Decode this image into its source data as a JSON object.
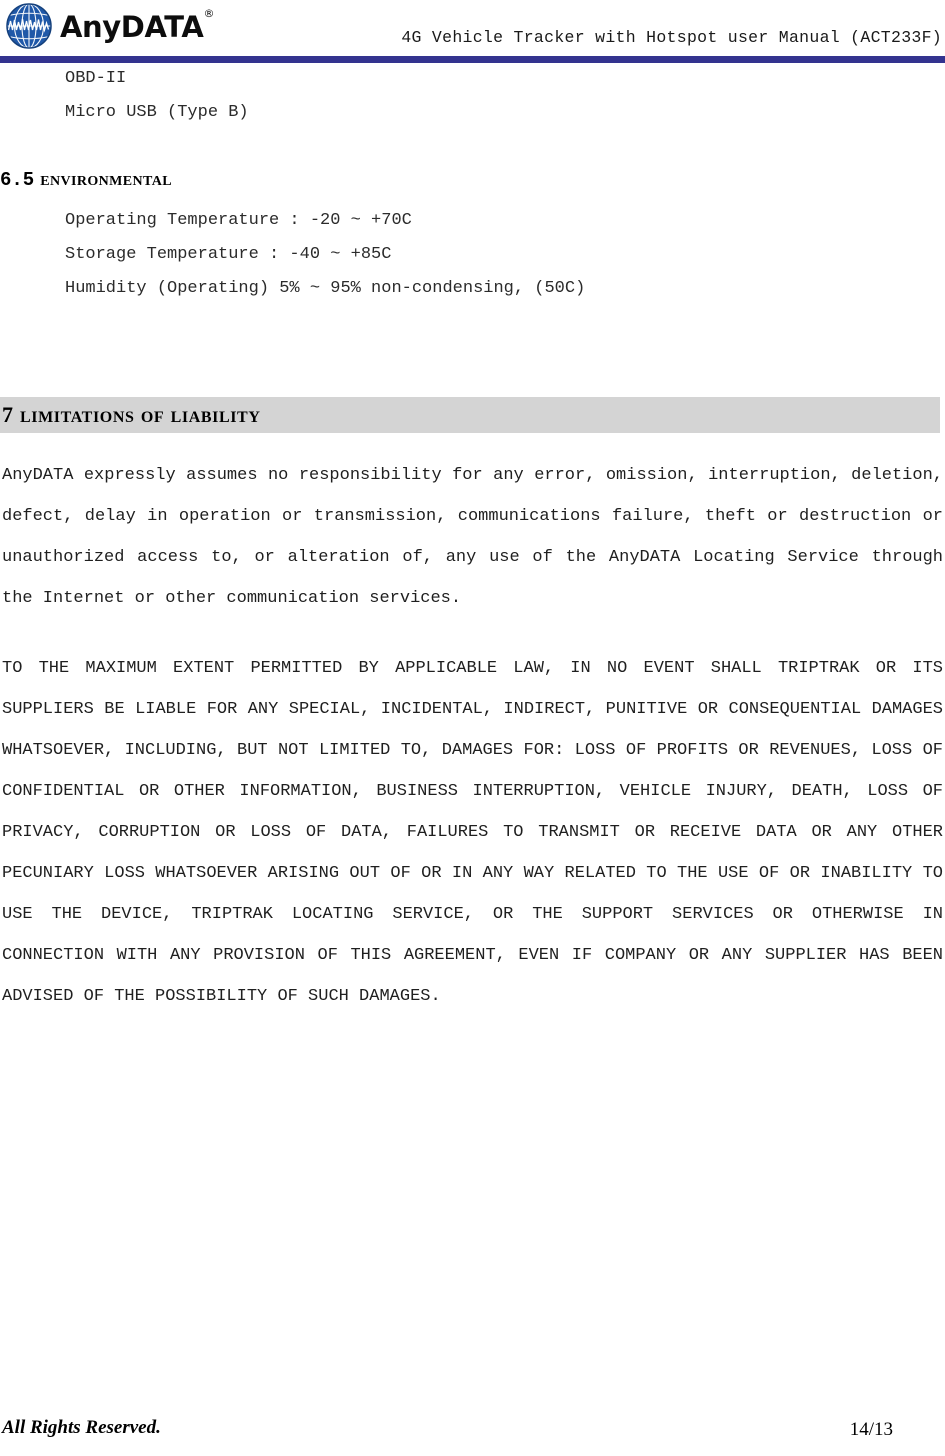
{
  "header": {
    "brand_name": "AnyDATA",
    "brand_trademark": "®",
    "logo_icon": "globe-icon",
    "title": "4G Vehicle Tracker with Hotspot user Manual (ACT233F)",
    "rule_color": "#33338f"
  },
  "content": {
    "interface_specs": [
      "OBD-II",
      "Micro USB (Type B)"
    ],
    "environmental_heading": {
      "number": "6.5",
      "title": "Environmental"
    },
    "environmental_specs": [
      "Operating Temperature : -20 ~ +70C",
      "Storage Temperature : -40 ~ +85C",
      "Humidity (Operating) 5% ~ 95% non-condensing, (50C)"
    ],
    "liability_heading": {
      "number": "7",
      "title": "Limitations of Liability",
      "band_color": "#d4d4d4"
    },
    "paragraphs": [
      "AnyDATA expressly assumes no responsibility for any error, omission, interruption, deletion, defect, delay in operation or transmission, communications failure, theft or destruction or unauthorized access to, or alteration of, any use of the AnyDATA Locating Service through the Internet or other communication services.",
      "TO THE MAXIMUM EXTENT PERMITTED BY APPLICABLE LAW, IN NO EVENT SHALL TRIPTRAK OR ITS SUPPLIERS BE LIABLE FOR ANY SPECIAL, INCIDENTAL, INDIRECT, PUNITIVE OR CONSEQUENTIAL DAMAGES WHATSOEVER, INCLUDING, BUT NOT LIMITED TO, DAMAGES FOR: LOSS OF PROFITS OR REVENUES, LOSS OF CONFIDENTIAL OR OTHER INFORMATION, BUSINESS  INTERRUPTION, VEHICLE INJURY, DEATH, LOSS OF PRIVACY, CORRUPTION OR LOSS OF DATA, FAILURES TO TRANSMIT OR RECEIVE DATA OR ANY OTHER PECUNIARY LOSS WHATSOEVER ARISING OUT OF OR IN ANY WAY RELATED TO THE USE OF OR INABILITY TO USE THE DEVICE, TRIPTRAK LOCATING SERVICE, OR THE SUPPORT SERVICES OR OTHERWISE IN CONNECTION WITH ANY PROVISION OF THIS AGREEMENT, EVEN IF COMPANY OR ANY SUPPLIER HAS BEEN ADVISED OF THE POSSIBILITY OF SUCH DAMAGES."
    ]
  },
  "footer": {
    "rights": "All Rights Reserved.",
    "page_number": "14/13"
  }
}
